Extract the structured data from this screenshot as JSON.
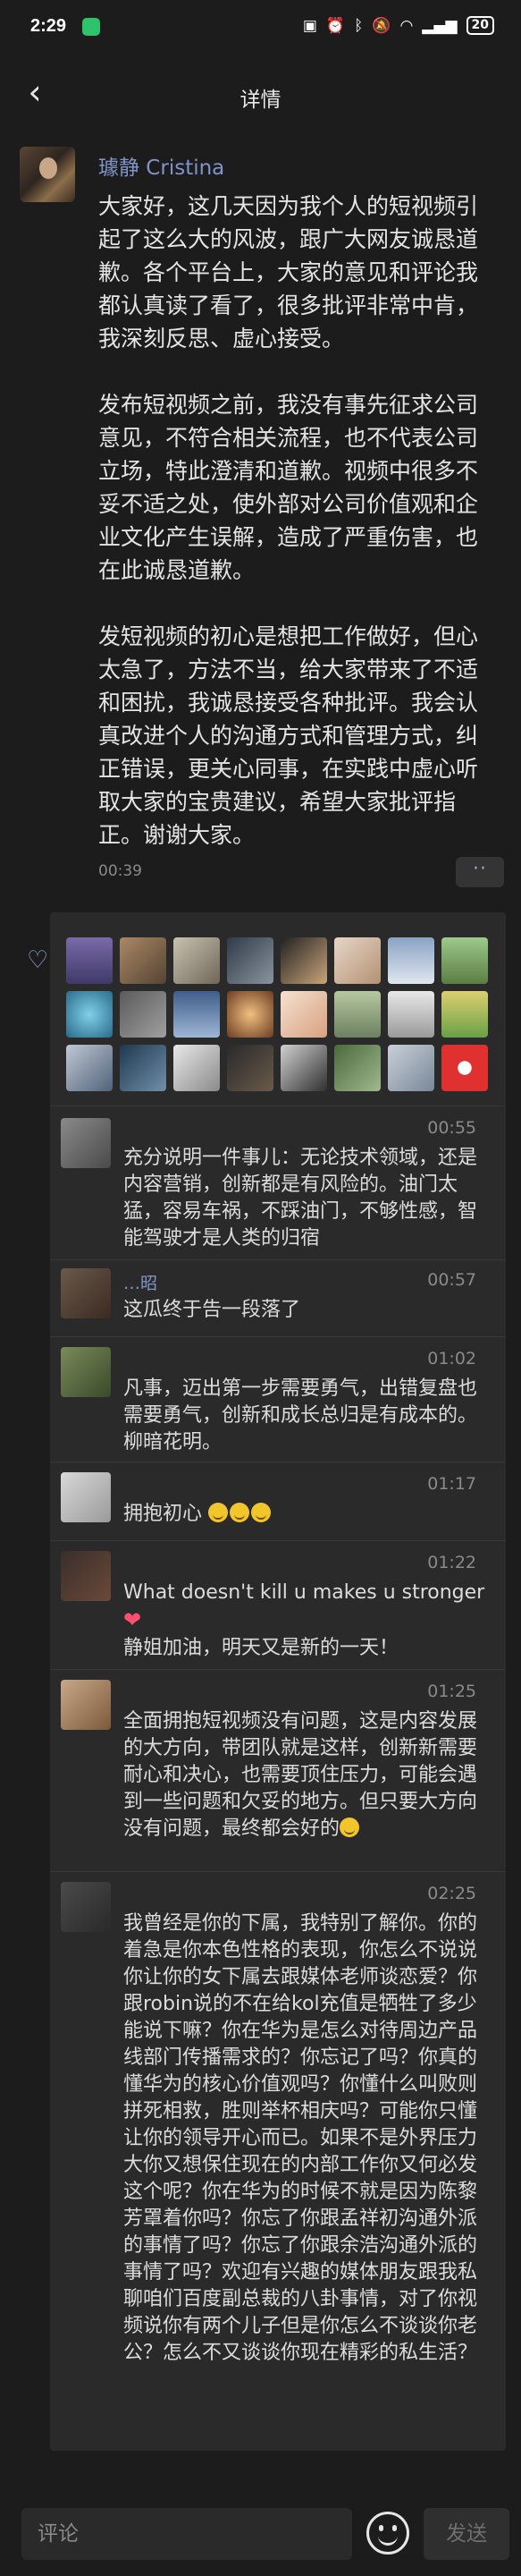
{
  "status_bar": {
    "time": "2:29",
    "battery": "20"
  },
  "nav": {
    "title": "详情",
    "back_icon": "chevron-left-icon"
  },
  "post": {
    "author": "璩静 Cristina",
    "paragraphs": [
      "大家好，这几天因为我个人的短视频引起了这么大的风波，跟广大网友诚恳道歉。各个平台上，大家的意见和评论我都认真读了看了，很多批评非常中肯，我深刻反思、虚心接受。",
      "发布短视频之前，我没有事先征求公司意见，不符合相关流程，也不代表公司立场，特此澄清和道歉。视频中很多不妥不适之处，使外部对公司价值观和企业文化产生误解，造成了严重伤害，也在此诚恳道歉。",
      "发短视频的初心是想把工作做好，但心太急了，方法不当，给大家带来了不适和困扰，我诚恳接受各种批评。我会认真改进个人的沟通方式和管理方式，纠正错误，更关心同事，在实践中虚心听取大家的宝贵建议，希望大家批评指正。谢谢大家。"
    ],
    "time": "00:39",
    "more_label": "··"
  },
  "comments": [
    {
      "time": "00:55",
      "text": "充分说明一件事儿：无论技术领域，还是内容营销，创新都是有风险的。油门太猛，容易车祸，不踩油门，不够性感，智能驾驶才是人类的归宿"
    },
    {
      "name": "…昭",
      "time": "00:57",
      "text": "这瓜终于告一段落了"
    },
    {
      "time": "01:02",
      "text": "凡事，迈出第一步需要勇气，出错复盘也需要勇气，创新和成长总归是有成本的。柳暗花明。"
    },
    {
      "time": "01:17",
      "text": "拥抱初心"
    },
    {
      "time": "01:22",
      "text": "What doesn't kill u makes u stronger",
      "text2": "静姐加油，明天又是新的一天！"
    },
    {
      "time": "01:25",
      "text": "全面拥抱短视频没有问题，这是内容发展的大方向，带团队就是这样，创新新需要耐心和决心，也需要顶住压力，可能会遇到一些问题和欠妥的地方。但只要大方向没有问题，最终都会好的"
    },
    {
      "time": "02:25",
      "text": "我曾经是你的下属，我特别了解你。你的着急是你本色性格的表现，你怎么不说说你让你的女下属去跟媒体老师谈恋爱？你跟robin说的不在给kol充值是牺牲了多少能说下嘛？你在华为是怎么对待周边产品线部门传播需求的？你忘记了吗？你真的懂华为的核心价值观吗？你懂什么叫败则拼死相救，胜则举杯相庆吗？可能你只懂让你的领导开心而已。如果不是外界压力大你又想保住现在的内部工作你又何必发这个呢？你在华为的时候不就是因为陈黎芳罩着你吗？你忘了你跟孟祥初沟通外派的事情了吗？你忘了你跟余浩沟通外派的事情了吗？欢迎有兴趣的媒体朋友跟我私聊咱们百度副总裁的八卦事情，对了你视频说你有两个儿子但是你怎么不谈谈你老公？怎么不又谈谈你现在精彩的私生活？"
    }
  ],
  "input": {
    "placeholder": "评论",
    "send_label": "发送"
  }
}
